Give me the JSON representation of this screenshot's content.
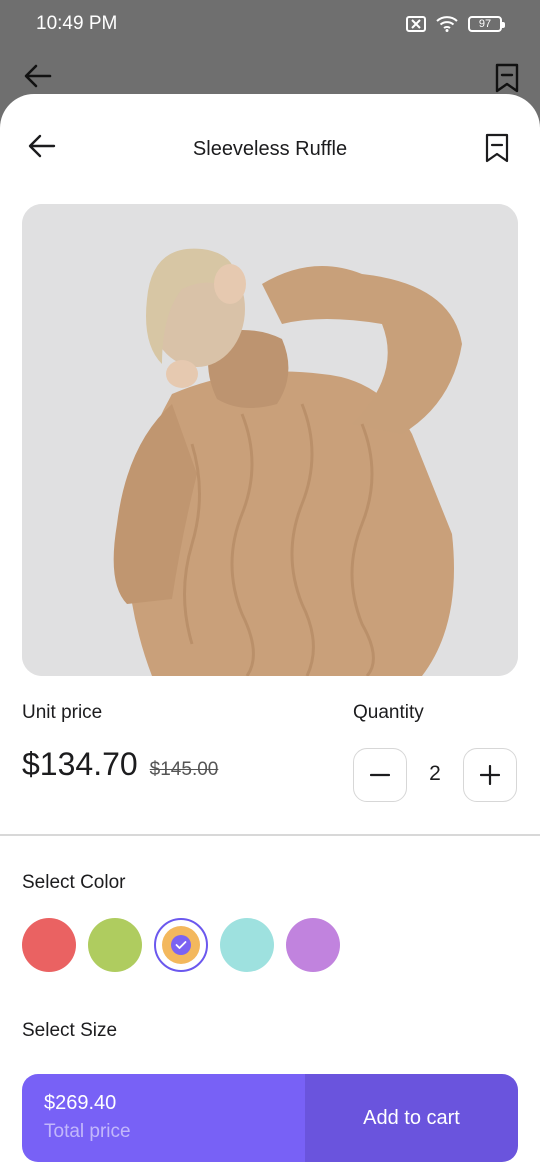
{
  "status_bar": {
    "time": "10:49 PM",
    "battery": "97",
    "icons": [
      "close-box-icon",
      "wifi-icon",
      "battery-icon"
    ]
  },
  "backdrop": {
    "icons": [
      "back-arrow-icon",
      "bookmark-icon"
    ]
  },
  "header": {
    "title": "Sleeveless Ruffle",
    "icons": [
      "back-arrow-icon",
      "bookmark-icon"
    ]
  },
  "product": {
    "image_alt": "Model wearing a beige cable-knit sweater",
    "unit_price_label": "Unit price",
    "price": "$134.70",
    "old_price": "$145.00"
  },
  "quantity": {
    "label": "Quantity",
    "value": "2",
    "minus_icon": "minus-icon",
    "plus_icon": "plus-icon"
  },
  "color": {
    "label": "Select Color",
    "options": [
      {
        "name": "red",
        "hex": "#ea6262",
        "selected": false
      },
      {
        "name": "green",
        "hex": "#afcc5f",
        "selected": false
      },
      {
        "name": "orange",
        "hex": "#f3b85d",
        "selected": true
      },
      {
        "name": "teal",
        "hex": "#9ee1df",
        "selected": false
      },
      {
        "name": "purple",
        "hex": "#c183de",
        "selected": false
      }
    ]
  },
  "size": {
    "label": "Select Size"
  },
  "cta": {
    "total_value": "$269.40",
    "total_label": "Total price",
    "add_label": "Add to cart",
    "colors": {
      "left": "#7861f6",
      "right": "#6a54dd"
    }
  }
}
